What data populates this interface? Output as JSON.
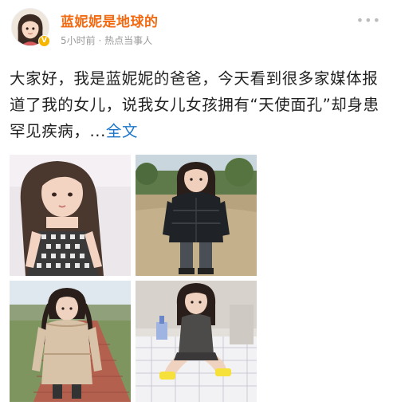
{
  "post": {
    "author": "蓝妮妮是地球的",
    "verified_badge": "V",
    "time": "5小时前",
    "separator": " · ",
    "source": "热点当事人",
    "more_icon": "ellipsis-icon",
    "more_label": "•••",
    "text": "大家好，我是蓝妮妮的爸爸，今天看到很多家媒体报道了我的女儿，说我女儿女孩拥有“天使面孔”却身患罕见疾病，...",
    "full_text_link": "全文",
    "photos": [
      {
        "name": "photo-girl-checkered-dress"
      },
      {
        "name": "photo-girl-black-jacket"
      },
      {
        "name": "photo-girl-pigtails-beige-coat"
      },
      {
        "name": "photo-girl-sitting-on-bed"
      }
    ]
  },
  "colors": {
    "author": "#f26a12",
    "link": "#1a73c8",
    "meta": "#9a9a9a",
    "text": "#222222"
  }
}
